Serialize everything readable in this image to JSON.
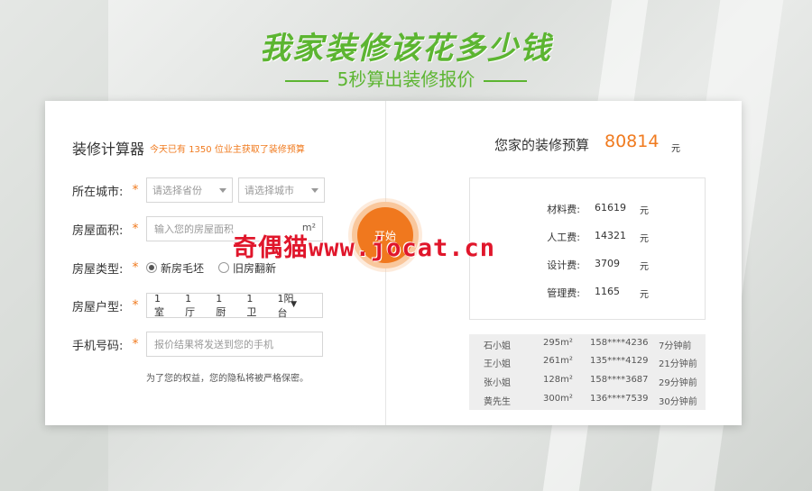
{
  "hero": {
    "title": "我家装修该花多少钱",
    "subtitle": "5秒算出装修报价"
  },
  "calculator": {
    "title": "装修计算器",
    "subtitle_prefix": "今天已有",
    "subtitle_count": "1350",
    "subtitle_suffix": "位业主获取了装修预算",
    "city": {
      "label": "所在城市:",
      "province_placeholder": "请选择省份",
      "city_placeholder": "请选择城市"
    },
    "area": {
      "label": "房屋面积:",
      "placeholder": "输入您的房屋面积",
      "unit": "m²"
    },
    "house_type": {
      "label": "房屋类型:",
      "options": [
        "新房毛坯",
        "旧房翻新"
      ],
      "selected": "新房毛坯"
    },
    "layout": {
      "label": "房屋户型:",
      "parts": [
        "1室",
        "1厅",
        "1厨",
        "1卫",
        "1阳台"
      ]
    },
    "phone": {
      "label": "手机号码:",
      "placeholder": "报价结果将发送到您的手机"
    },
    "required_mark": "*",
    "privacy_note": "为了您的权益，您的隐私将被严格保密。",
    "start_label": "开始"
  },
  "budget": {
    "title": "您家的装修预算",
    "total": "80814",
    "unit": "元",
    "items": [
      {
        "label": "材料费:",
        "value": "61619",
        "unit": "元"
      },
      {
        "label": "人工费:",
        "value": "14321",
        "unit": "元"
      },
      {
        "label": "设计费:",
        "value": "3709",
        "unit": "元"
      },
      {
        "label": "管理费:",
        "value": "1165",
        "unit": "元"
      }
    ]
  },
  "records": [
    {
      "name": "石小姐",
      "area": "295m²",
      "phone": "158****4236",
      "time": "7分钟前"
    },
    {
      "name": "王小姐",
      "area": "261m²",
      "phone": "135****4129",
      "time": "21分钟前"
    },
    {
      "name": "张小姐",
      "area": "128m²",
      "phone": "158****3687",
      "time": "29分钟前"
    },
    {
      "name": "黄先生",
      "area": "300m²",
      "phone": "136****7539",
      "time": "30分钟前"
    }
  ],
  "watermark": "奇偶猫www.jocat.cn"
}
